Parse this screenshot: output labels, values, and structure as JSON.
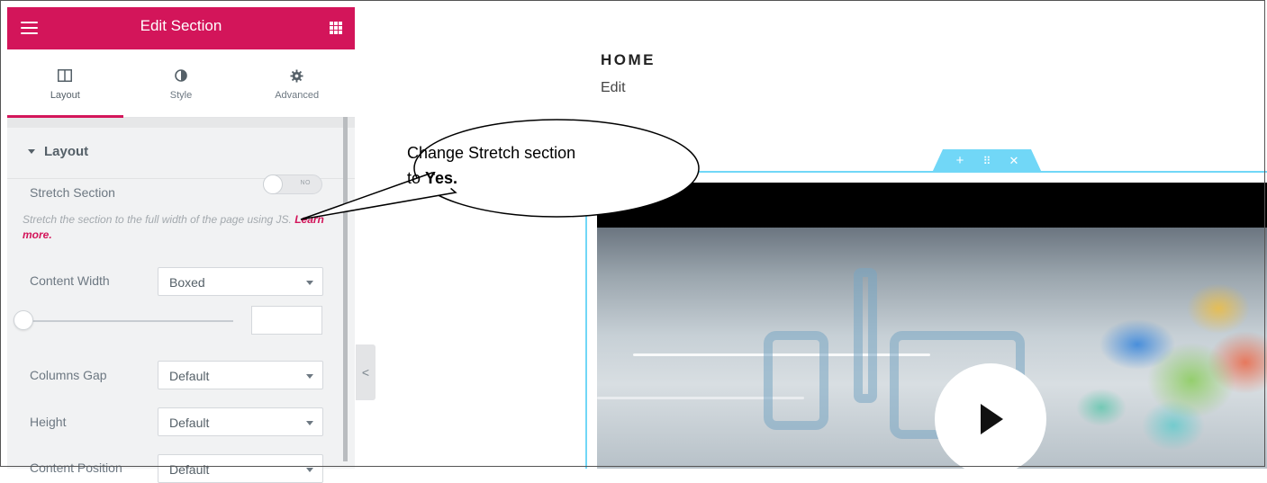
{
  "panel": {
    "header": {
      "title": "Edit Section",
      "menu_icon": "hamburger-icon",
      "apps_icon": "grid-icon",
      "accent": "#d3155a"
    },
    "tabs": [
      {
        "label": "Layout",
        "icon": "columns-icon",
        "active": true
      },
      {
        "label": "Style",
        "icon": "half-circle-icon",
        "active": false
      },
      {
        "label": "Advanced",
        "icon": "gear-icon",
        "active": false
      }
    ],
    "section_title": "Layout",
    "stretch": {
      "label": "Stretch Section",
      "toggle_state": "NO",
      "description": "Stretch the section to the full width of the page using JS.",
      "learn_more": "Learn more."
    },
    "content_width": {
      "label": "Content Width",
      "value": "Boxed"
    },
    "columns_gap": {
      "label": "Columns Gap",
      "value": "Default"
    },
    "height": {
      "label": "Height",
      "value": "Default"
    },
    "content_position": {
      "label": "Content Position",
      "value": "Default"
    }
  },
  "collapse_label": "<",
  "preview": {
    "menu_title": "HOME",
    "menu_edit": "Edit",
    "section_controls": {
      "add": "+",
      "move": "⠿",
      "close": "✕"
    },
    "accent": "#71d7f7"
  },
  "callout": {
    "text": "Change Stretch section",
    "prefix": "to ",
    "emphasis": "Yes."
  }
}
